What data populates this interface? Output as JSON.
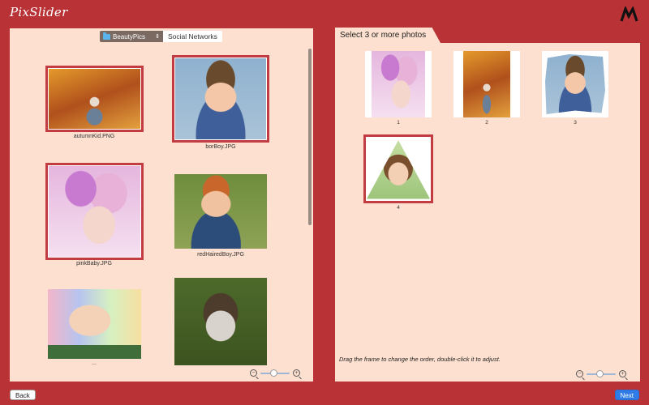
{
  "app": {
    "title": "PixSlider",
    "logo_text": "M"
  },
  "source": {
    "folder_label": "BeautyPics",
    "social_tab_label": "Social Networks"
  },
  "library": {
    "photos": [
      {
        "filename": "autumnKid.PNG",
        "selected": true
      },
      {
        "filename": "borBoy.JPG",
        "selected": true
      },
      {
        "filename": "pinkBaby.JPG",
        "selected": true
      },
      {
        "filename": "redHairedBoy.JPG",
        "selected": false
      },
      {
        "filename": "...",
        "selected": false
      },
      {
        "filename": "",
        "selected": false
      }
    ],
    "zoom_level": 0.45
  },
  "selection": {
    "tab_title": "Select 3 or more photos",
    "items": [
      {
        "order": "1"
      },
      {
        "order": "2"
      },
      {
        "order": "3"
      },
      {
        "order": "4"
      }
    ],
    "hint": "Drag the frame to change the order, double-click it to adjust.",
    "zoom_level": 0.45
  },
  "footer": {
    "back_label": "Back",
    "next_label": "Next"
  },
  "colors": {
    "background": "#b83236",
    "panel": "#fde0cf",
    "selection_border": "#c33c42",
    "next_button": "#2f7be8"
  }
}
